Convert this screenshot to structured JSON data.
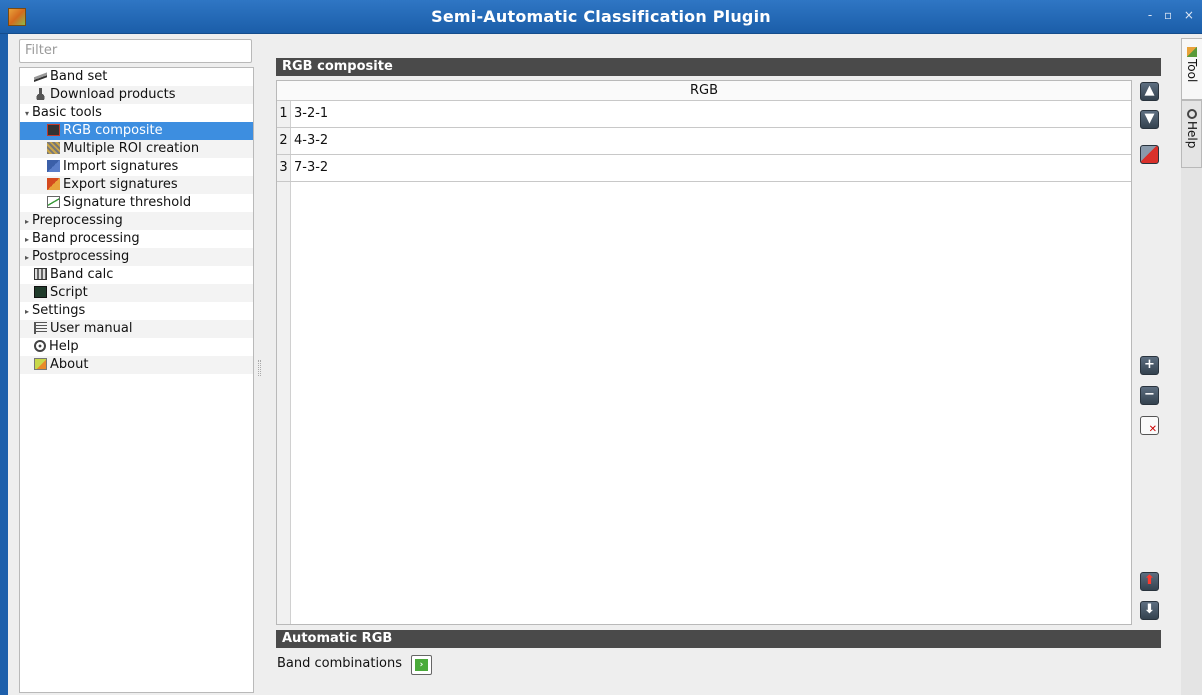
{
  "window": {
    "title": "Semi-Automatic Classification Plugin",
    "controls": "- ▫ ×"
  },
  "sidebar": {
    "filter_placeholder": "Filter",
    "items": [
      {
        "label": "Band set",
        "icon": "band-set-icon",
        "level": 1
      },
      {
        "label": "Download products",
        "icon": "download-icon",
        "level": 1
      },
      {
        "label": "Basic tools",
        "icon": "",
        "level": 0,
        "expanded": true
      },
      {
        "label": "RGB composite",
        "icon": "rgb-icon",
        "level": 2,
        "selected": true
      },
      {
        "label": "Multiple ROI creation",
        "icon": "roi-icon",
        "level": 2
      },
      {
        "label": "Import signatures",
        "icon": "import-icon",
        "level": 2
      },
      {
        "label": "Export signatures",
        "icon": "export-icon",
        "level": 2
      },
      {
        "label": "Signature threshold",
        "icon": "threshold-icon",
        "level": 2
      },
      {
        "label": "Preprocessing",
        "icon": "",
        "level": 0,
        "expanded": false
      },
      {
        "label": "Band processing",
        "icon": "",
        "level": 0,
        "expanded": false
      },
      {
        "label": "Postprocessing",
        "icon": "",
        "level": 0,
        "expanded": false
      },
      {
        "label": "Band calc",
        "icon": "band-calc-icon",
        "level": 1
      },
      {
        "label": "Script",
        "icon": "script-icon",
        "level": 1
      },
      {
        "label": "Settings",
        "icon": "",
        "level": 0,
        "expanded": false
      },
      {
        "label": "User manual",
        "icon": "manual-icon",
        "level": 1
      },
      {
        "label": "Help",
        "icon": "help-icon",
        "level": 1
      },
      {
        "label": "About",
        "icon": "about-icon",
        "level": 1
      }
    ]
  },
  "right_tabs": [
    {
      "label": "Tool",
      "active": true
    },
    {
      "label": "Help",
      "active": false
    }
  ],
  "rgb_composite": {
    "header": "RGB composite",
    "column": "RGB",
    "rows": [
      {
        "num": "1",
        "value": "3-2-1"
      },
      {
        "num": "2",
        "value": "4-3-2"
      },
      {
        "num": "3",
        "value": "7-3-2"
      }
    ]
  },
  "automatic_rgb": {
    "header": "Automatic RGB",
    "band_combinations_label": "Band combinations"
  }
}
